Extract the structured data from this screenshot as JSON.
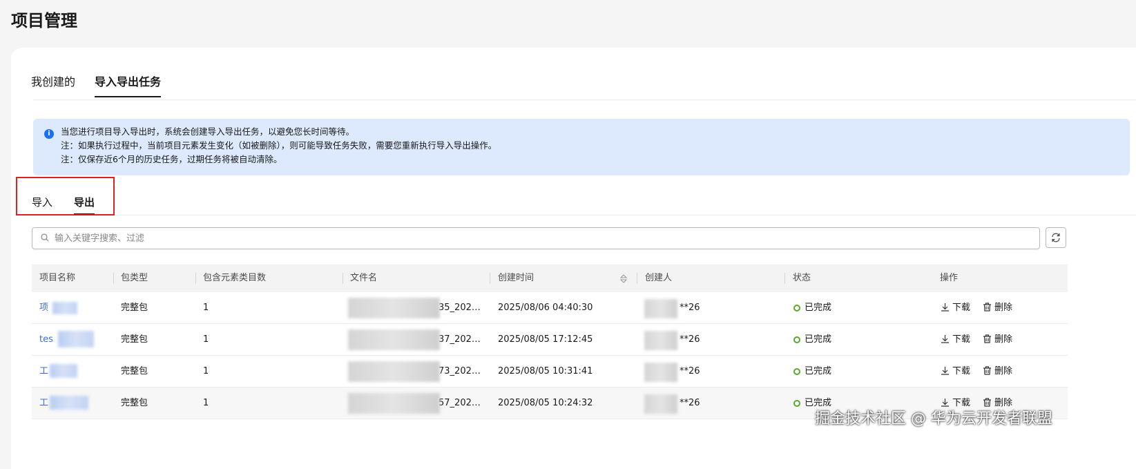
{
  "page": {
    "title": "项目管理"
  },
  "tabs": [
    {
      "label": "我创建的",
      "active": false
    },
    {
      "label": "导入导出任务",
      "active": true
    }
  ],
  "notice": {
    "lines": [
      "当您进行项目导入导出时，系统会创建导入导出任务，以避免您长时间等待。",
      "注：如果执行过程中，当前项目元素发生变化（如被删除），则可能导致任务失败，需要您重新执行导入导出操作。",
      "注：仅保存近6个月的历史任务，过期任务将被自动清除。"
    ]
  },
  "sub_tabs": [
    {
      "label": "导入",
      "active": false
    },
    {
      "label": "导出",
      "active": true
    }
  ],
  "search": {
    "placeholder": "输入关键字搜索、过滤",
    "value": ""
  },
  "table": {
    "columns": [
      "项目名称",
      "包类型",
      "包含元素类目数",
      "文件名",
      "创建时间",
      "创建人",
      "状态",
      "操作"
    ],
    "rows": [
      {
        "project": "项",
        "package_type": "完整包",
        "count": "1",
        "file": "35_202…",
        "created_at": "2025/08/06 04:40:30",
        "creator": "**26",
        "status": "已完成"
      },
      {
        "project": "tes",
        "package_type": "完整包",
        "count": "1",
        "file": "37_202…",
        "created_at": "2025/08/05 17:12:45",
        "creator": "**26",
        "status": "已完成"
      },
      {
        "project": "工",
        "package_type": "完整包",
        "count": "1",
        "file": "73_202…",
        "created_at": "2025/08/05 10:31:41",
        "creator": "**26",
        "status": "已完成"
      },
      {
        "project": "工",
        "package_type": "完整包",
        "count": "1",
        "file": "57_202…",
        "created_at": "2025/08/05 10:24:32",
        "creator": "**26",
        "status": "已完成"
      }
    ],
    "actions": {
      "download": "下载",
      "delete": "删除"
    }
  },
  "colors": {
    "link": "#3c6ec8",
    "status_done": "#58a82c",
    "notice_bg": "#dde9fd",
    "info_icon": "#1a6ff5",
    "highlight": "#e02020"
  },
  "icons": [
    "info-icon",
    "search-icon",
    "refresh-icon",
    "sort-icon",
    "status-dot-icon",
    "download-icon",
    "trash-icon"
  ],
  "watermark": "掘金技术社区 @ 华为云开发者联盟"
}
